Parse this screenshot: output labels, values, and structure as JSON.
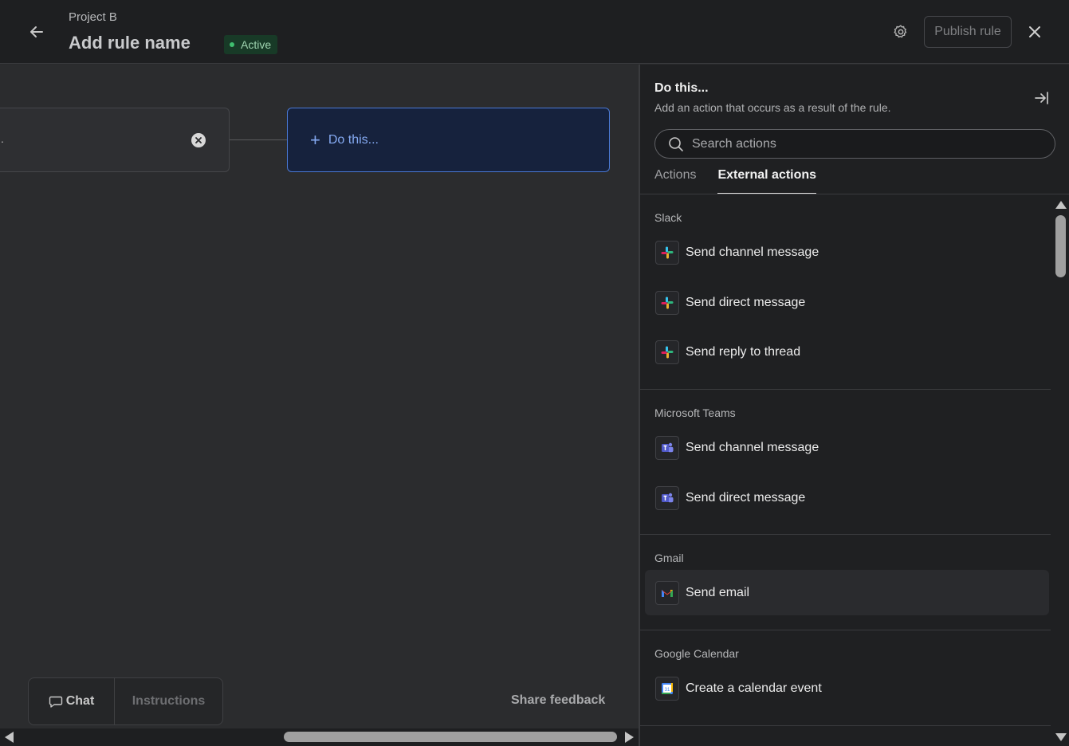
{
  "header": {
    "breadcrumb": "Project B",
    "title": "Add rule name",
    "status": "Active",
    "publish_label": "Publish rule",
    "colors": {
      "status_green": "#3fbf6f",
      "accent_blue": "#85aaf2"
    }
  },
  "canvas": {
    "trigger_text": ".",
    "action_label": "Do this...",
    "chat_label": "Chat",
    "instructions_label": "Instructions",
    "share_feedback": "Share feedback"
  },
  "panel": {
    "title": "Do this...",
    "subtitle": "Add an action that occurs as a result of the rule.",
    "search_placeholder": "Search actions",
    "tabs": [
      {
        "label": "Actions",
        "active": false
      },
      {
        "label": "External actions",
        "active": true
      }
    ],
    "groups": [
      {
        "name": "Slack",
        "icon": "slack-icon",
        "items": [
          "Send channel message",
          "Send direct message",
          "Send reply to thread"
        ]
      },
      {
        "name": "Microsoft Teams",
        "icon": "teams-icon",
        "items": [
          "Send channel message",
          "Send direct message"
        ]
      },
      {
        "name": "Gmail",
        "icon": "gmail-icon",
        "items": [
          "Send email"
        ]
      },
      {
        "name": "Google Calendar",
        "icon": "google-calendar-icon",
        "items": [
          "Create a calendar event"
        ]
      }
    ]
  }
}
